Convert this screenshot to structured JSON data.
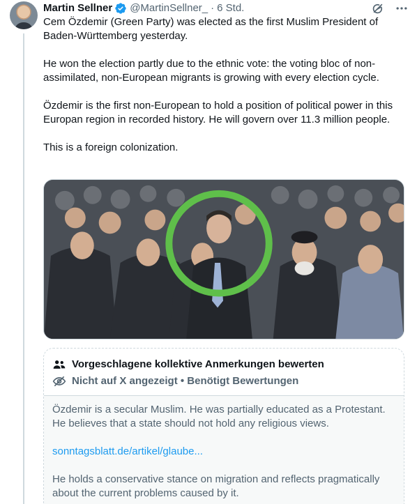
{
  "author": {
    "name": "Martin Sellner",
    "handle": "@MartinSellner_",
    "separator": "·",
    "time": "6 Std.",
    "verified": true,
    "accent": "#1d9bf0"
  },
  "tweet": {
    "paragraphs": [
      "Cem Özdemir (Green Party) was elected as the first Muslim President of Baden-Württemberg yesterday.",
      "He won the election partly due to the ethnic vote: the voting bloc of non-assimilated, non-European migrants is growing with every election cycle.",
      "Özdemir is the first non-European to hold a position of political power in this Europan region in recorded history. He will govern over 11.3 million people.",
      "This is a  foreign colonization."
    ]
  },
  "media": {
    "highlight_color": "#5fbf4a"
  },
  "community_note": {
    "title": "Vorgeschlagene kollektive Anmerkungen bewerten",
    "status": "Nicht auf X angezeigt • Benötigt Bewertungen",
    "body": [
      "Özdemir is a secular Muslim. He was partially educated as a Protestant. He believes that a state should not hold any religious views.",
      "He holds a conservative stance on migration and reflects pragmatically about the current problems caused by it."
    ],
    "link": "sonntagsblatt.de/artikel/glaube..."
  },
  "icons": {
    "verified": "verified-badge-icon",
    "grok": "grok-icon",
    "more": "more-icon",
    "people": "people-icon",
    "hidden": "eye-off-icon"
  }
}
